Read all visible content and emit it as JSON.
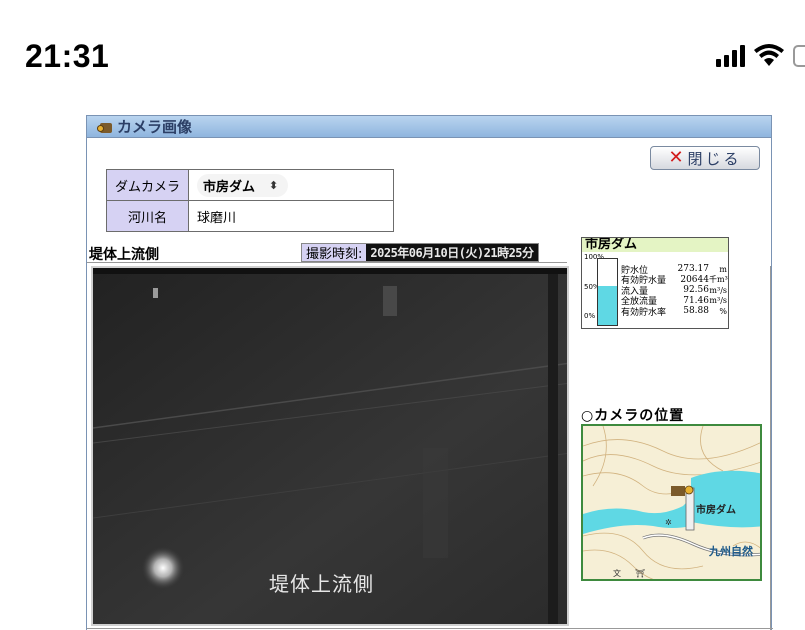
{
  "status_bar": {
    "time": "21:31",
    "icons": [
      "signal-icon",
      "wifi-icon",
      "battery-icon"
    ]
  },
  "window": {
    "title": "カメラ画像",
    "close_button_label": "閉じる"
  },
  "info_table": {
    "rows": [
      {
        "key": "ダムカメラ",
        "value": "市房ダム"
      },
      {
        "key": "河川名",
        "value": "球磨川"
      }
    ]
  },
  "camera": {
    "location_label": "堤体上流側",
    "shot_time_label": "撮影時刻:",
    "shot_time_value": "2025年06月10日(火)21時25分",
    "overlay_caption": "堤体上流側"
  },
  "dam_status": {
    "name": "市房ダム",
    "gauge_percent": 58.88,
    "scale_labels": [
      "100%",
      "50%",
      "0%"
    ],
    "rows": [
      {
        "label": "貯水位",
        "value": "273.17",
        "unit": "m"
      },
      {
        "label": "有効貯水量",
        "value": "20644",
        "unit": "千m³"
      },
      {
        "label": "流入量",
        "value": "92.56",
        "unit": "m³/s"
      },
      {
        "label": "全放流量",
        "value": "71.46",
        "unit": "m³/s"
      },
      {
        "label": "有効貯水率",
        "value": "58.88",
        "unit": "%"
      }
    ]
  },
  "map": {
    "title": "○カメラの位置",
    "labels": [
      "市房ダム",
      "九州自然"
    ]
  },
  "colors": {
    "table_key_bg": "#d6d2f3",
    "gauge_fill": "#5fd8e4",
    "title_bar": "#8fb5de",
    "close_x": "#d21c1c"
  }
}
